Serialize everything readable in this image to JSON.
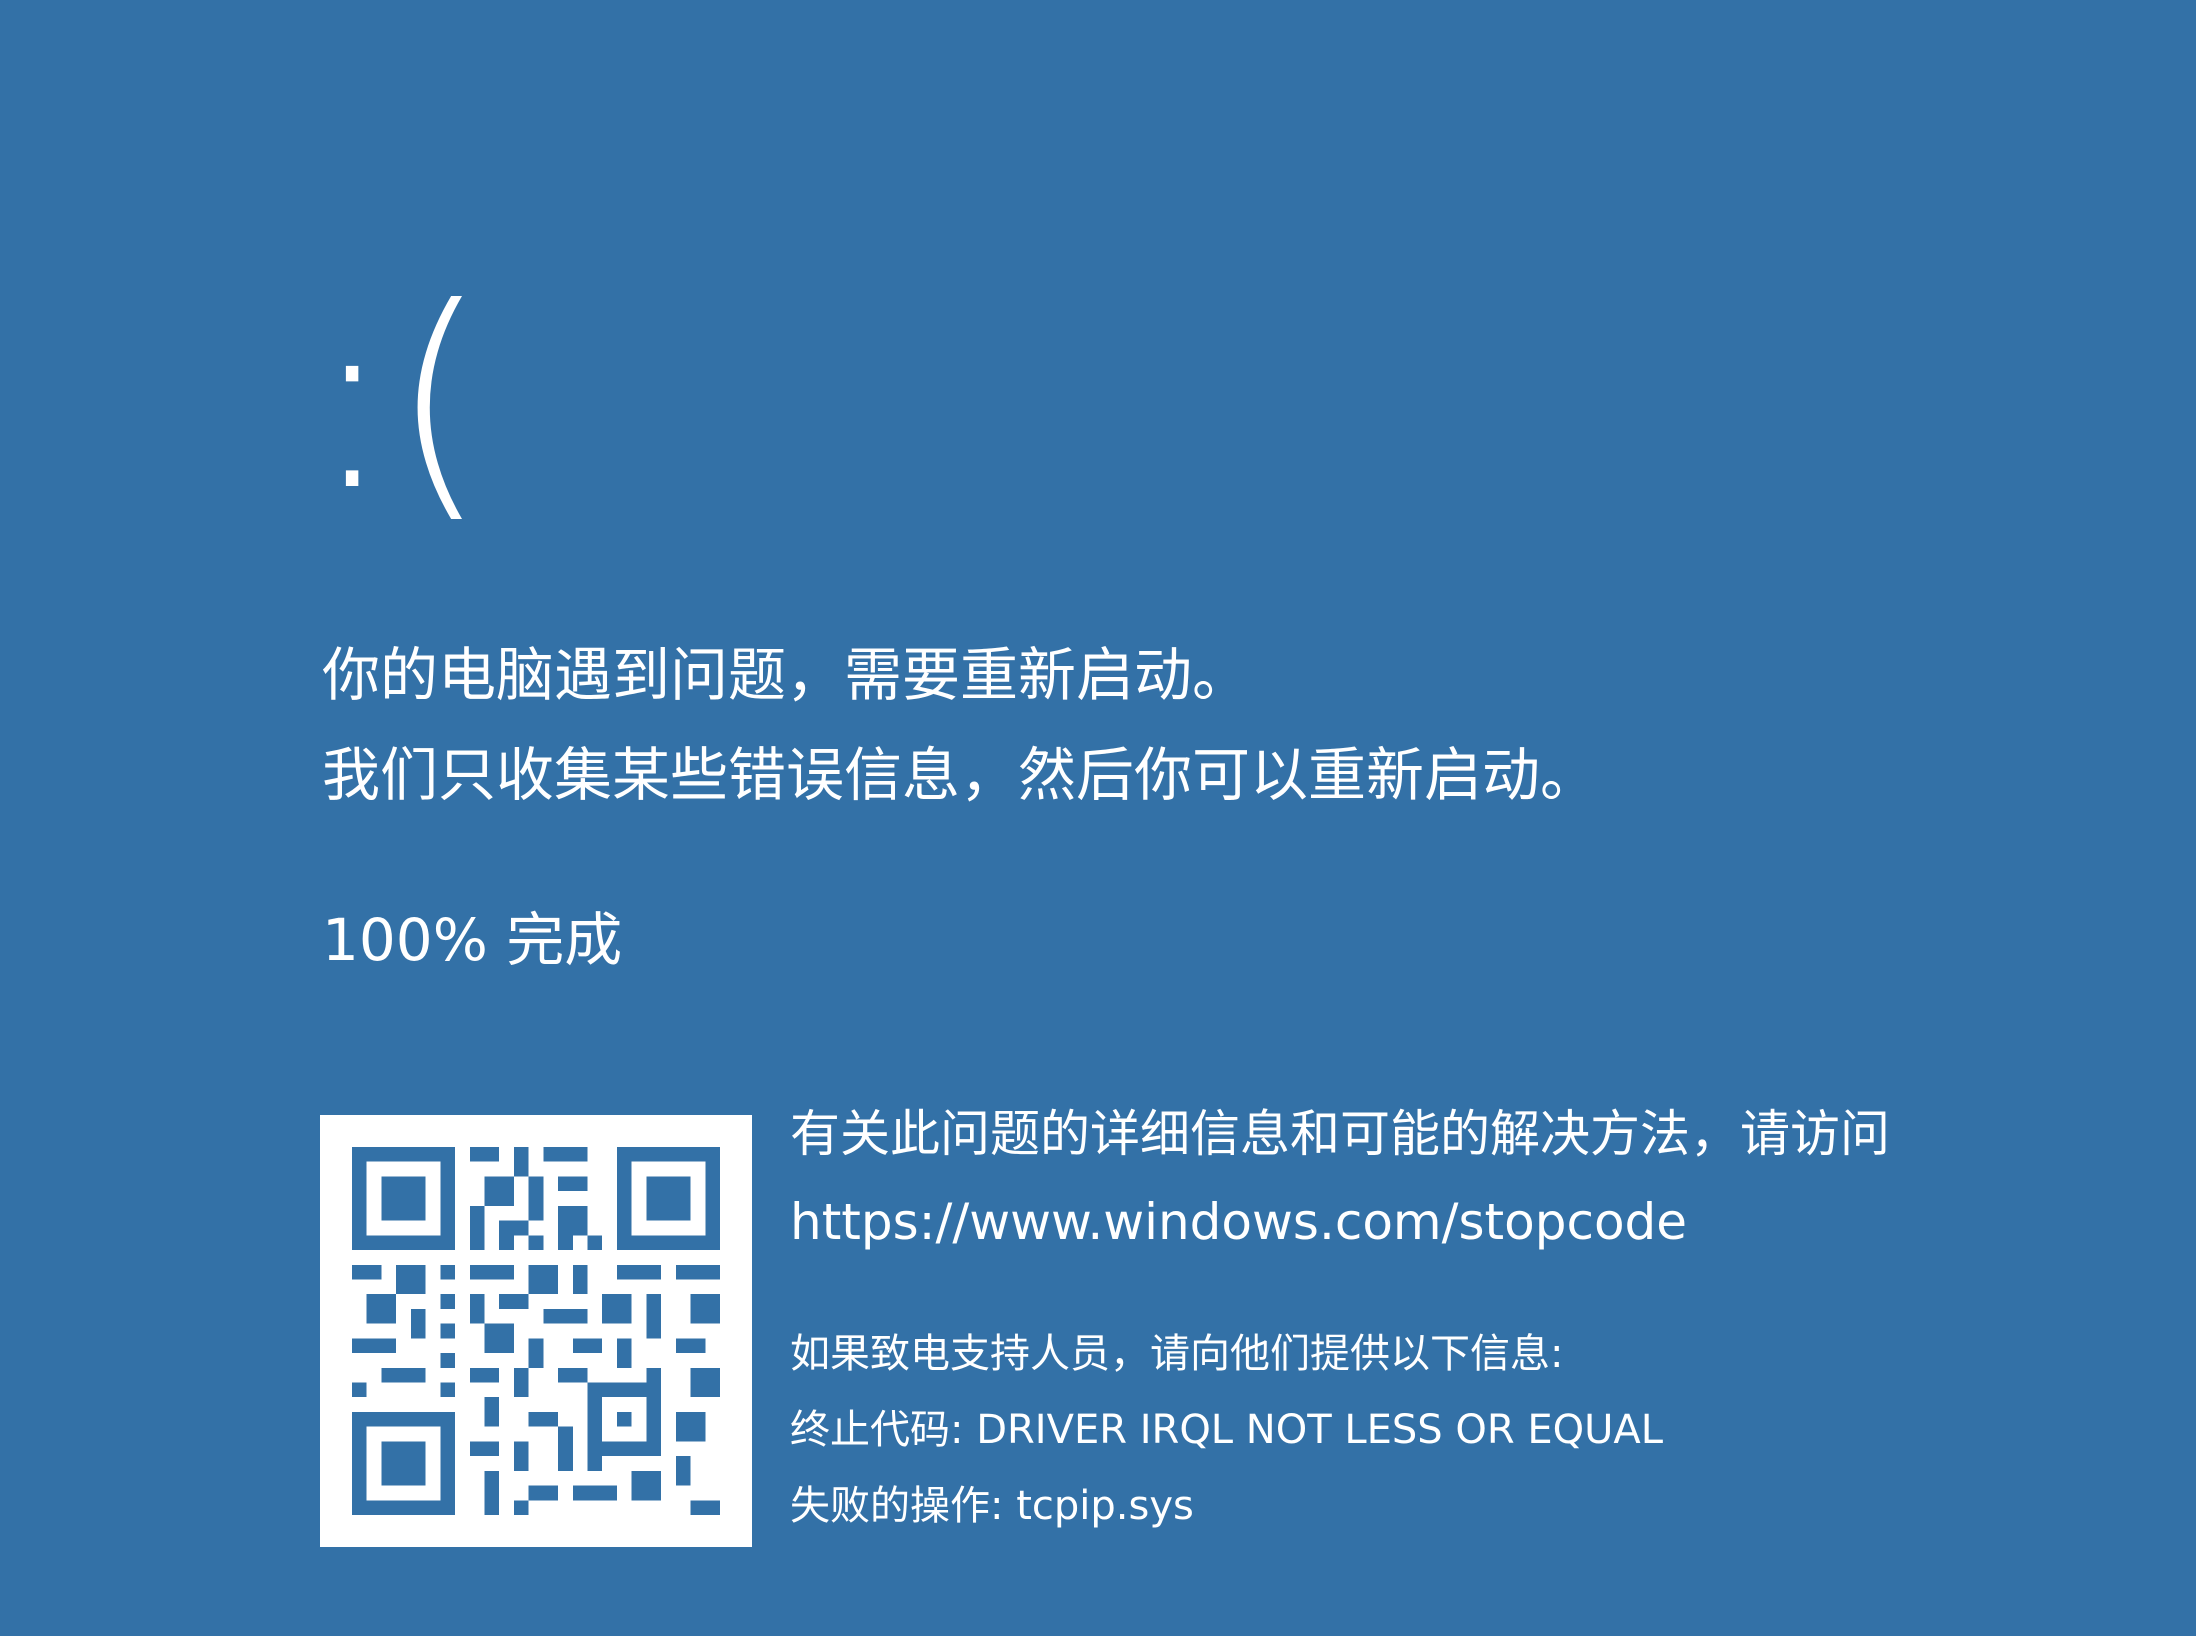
{
  "screen": {
    "background_color": "#3371a7",
    "text_color": "#ffffff",
    "sad_face": ":(",
    "message_line1": "你的电脑遇到问题，需要重新启动。",
    "message_line2": "我们只收集某些错误信息，然后你可以重新启动。",
    "progress_text": "100% 完成"
  },
  "qr": {
    "icon": "qr-code-icon"
  },
  "info": {
    "details_text": "有关此问题的详细信息和可能的解决方法，请访问",
    "url": "https://www.windows.com/stopcode",
    "support_intro": "如果致电支持人员，请向他们提供以下信息:",
    "stop_code_line": "终止代码: DRIVER IRQL NOT LESS OR EQUAL",
    "failed_line": "失败的操作: tcpip.sys"
  }
}
